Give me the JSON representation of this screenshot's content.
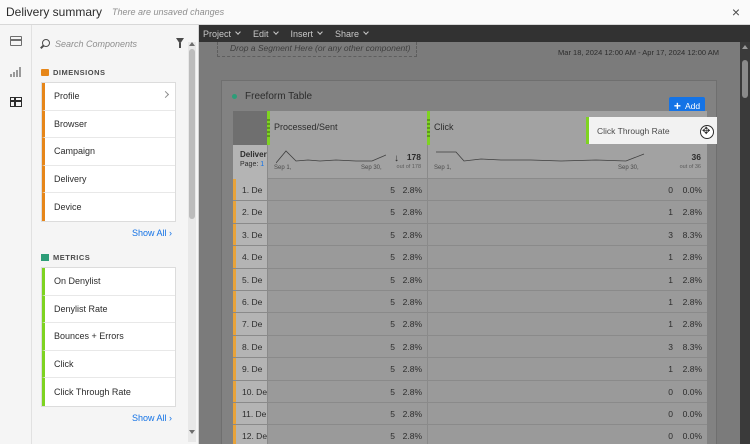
{
  "window": {
    "title": "Delivery summary",
    "unsaved_note": "There are unsaved changes",
    "close_icon": "×"
  },
  "rail": {
    "icons": [
      "panels-icon",
      "visualizations-icon",
      "components-icon"
    ]
  },
  "components": {
    "search_placeholder": "Search Components",
    "dimensions": {
      "heading": "DIMENSIONS",
      "items": [
        "Profile",
        "Browser",
        "Campaign",
        "Delivery",
        "Device"
      ],
      "show_all": "Show All ›"
    },
    "metrics": {
      "heading": "METRICS",
      "items": [
        "On Denylist",
        "Denylist Rate",
        "Bounces + Errors",
        "Click",
        "Click Through Rate"
      ],
      "show_all": "Show All ›"
    }
  },
  "menubar": {
    "items": [
      "Project",
      "Edit",
      "Insert",
      "Share"
    ]
  },
  "workspace": {
    "drop_segment": "Drop a Segment Here (or any other component)",
    "date_range": "Mar 18, 2024 12:00 AM - Apr 17, 2024 12:00 AM",
    "panel_title": "Freeform Table",
    "add_button": "Add"
  },
  "table": {
    "columns": [
      "Processed/Sent",
      "Click"
    ],
    "dragging_column": "Click Through Rate",
    "summary": {
      "dim_label": "Delivery",
      "page_label": "Page:",
      "page_num": "1",
      "col1": {
        "total": "178",
        "out_of": "out of 178",
        "axis_start": "Sep 1,",
        "axis_end": "Sep 30,"
      },
      "col2": {
        "total": "36",
        "out_of": "out of 36",
        "axis_start": "Sep 1,",
        "axis_end": "Sep 30,"
      }
    },
    "rows": [
      {
        "label": "1. De",
        "c1n": "5",
        "c1p": "2.8%",
        "c2n": "0",
        "c2p": "0.0%"
      },
      {
        "label": "2. De",
        "c1n": "5",
        "c1p": "2.8%",
        "c2n": "1",
        "c2p": "2.8%"
      },
      {
        "label": "3. De",
        "c1n": "5",
        "c1p": "2.8%",
        "c2n": "3",
        "c2p": "8.3%"
      },
      {
        "label": "4. De",
        "c1n": "5",
        "c1p": "2.8%",
        "c2n": "1",
        "c2p": "2.8%"
      },
      {
        "label": "5. De",
        "c1n": "5",
        "c1p": "2.8%",
        "c2n": "1",
        "c2p": "2.8%"
      },
      {
        "label": "6. De",
        "c1n": "5",
        "c1p": "2.8%",
        "c2n": "1",
        "c2p": "2.8%"
      },
      {
        "label": "7. De",
        "c1n": "5",
        "c1p": "2.8%",
        "c2n": "1",
        "c2p": "2.8%"
      },
      {
        "label": "8. De",
        "c1n": "5",
        "c1p": "2.8%",
        "c2n": "3",
        "c2p": "8.3%"
      },
      {
        "label": "9. De",
        "c1n": "5",
        "c1p": "2.8%",
        "c2n": "1",
        "c2p": "2.8%"
      },
      {
        "label": "10. De",
        "c1n": "5",
        "c1p": "2.8%",
        "c2n": "0",
        "c2p": "0.0%"
      },
      {
        "label": "11. De",
        "c1n": "5",
        "c1p": "2.8%",
        "c2n": "0",
        "c2p": "0.0%"
      },
      {
        "label": "12. De",
        "c1n": "5",
        "c1p": "2.8%",
        "c2n": "0",
        "c2p": "0.0%"
      }
    ]
  },
  "colors": {
    "dimension_accent": "#e68619",
    "metric_accent": "#7ed321",
    "link": "#1473e6",
    "add_button": "#1473e6"
  }
}
